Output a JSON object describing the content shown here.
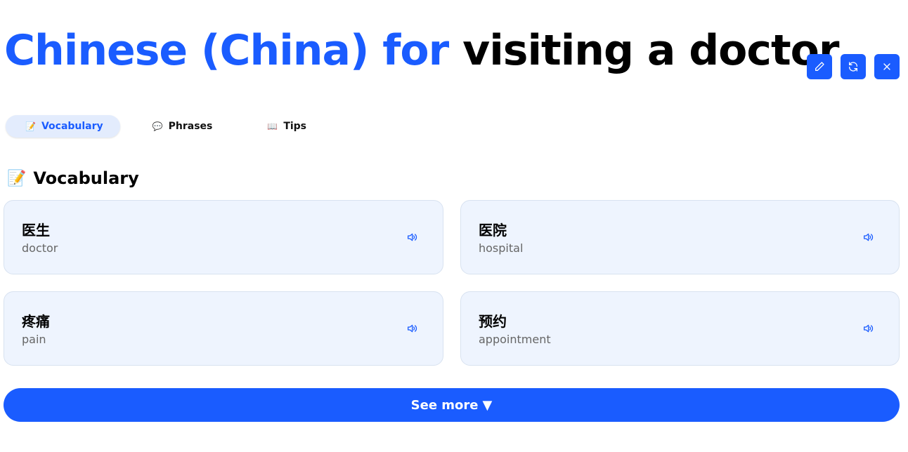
{
  "header": {
    "title_accent": "Chinese (China) for",
    "title_rest": "visiting a doctor"
  },
  "toolbar": {
    "edit_icon": "pencil-icon",
    "refresh_icon": "refresh-icon",
    "close_icon": "close-icon"
  },
  "tabs": [
    {
      "icon": "📝",
      "label": "Vocabulary",
      "active": true
    },
    {
      "icon": "💬",
      "label": "Phrases",
      "active": false
    },
    {
      "icon": "📖",
      "label": "Tips",
      "active": false
    }
  ],
  "section": {
    "icon": "📝",
    "heading": "Vocabulary"
  },
  "vocabulary": [
    {
      "word": "医生",
      "meaning": "doctor"
    },
    {
      "word": "医院",
      "meaning": "hospital"
    },
    {
      "word": "疼痛",
      "meaning": "pain"
    },
    {
      "word": "预约",
      "meaning": "appointment"
    }
  ],
  "see_more": {
    "label": "See more",
    "arrow": "▼"
  },
  "colors": {
    "accent": "#1a5cff",
    "card_bg": "#eef4fe",
    "tab_active_bg": "#e3ecfd"
  }
}
